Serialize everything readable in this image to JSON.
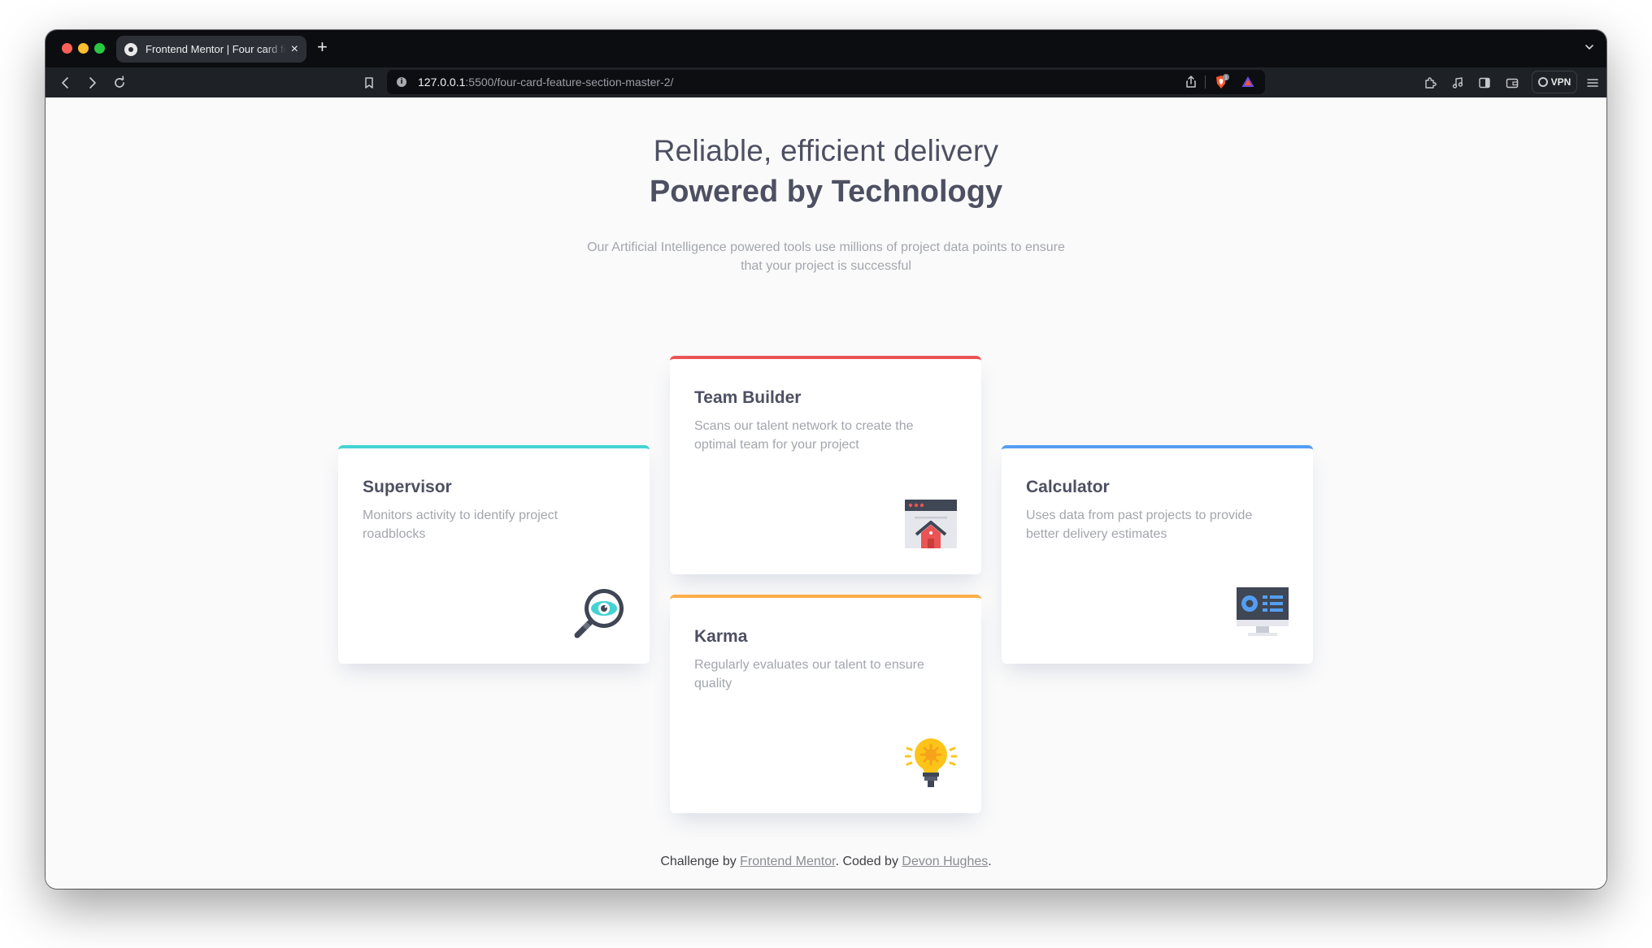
{
  "browser": {
    "tab_title": "Frontend Mentor | Four card feature section",
    "tab_close": "×",
    "new_tab": "+",
    "url_host": "127.0.0.1",
    "url_path": ":5500/four-card-feature-section-master-2/",
    "vpn_label": "VPN",
    "brave_badge_count": "1"
  },
  "hero": {
    "line1": "Reliable, efficient delivery",
    "line2": "Powered by Technology",
    "description": "Our Artificial Intelligence powered tools use millions of project data points to ensure that your project is successful"
  },
  "cards": {
    "supervisor": {
      "title": "Supervisor",
      "desc": "Monitors activity to identify project roadblocks",
      "accent": "#44d3d2",
      "icon": "magnifier-icon"
    },
    "team_builder": {
      "title": "Team Builder",
      "desc": "Scans our talent network to create the optimal team for your project",
      "accent": "#ea5454",
      "icon": "team-builder-icon"
    },
    "karma": {
      "title": "Karma",
      "desc": "Regularly evaluates our talent to ensure quality",
      "accent": "#fcae4a",
      "icon": "lightbulb-icon"
    },
    "calculator": {
      "title": "Calculator",
      "desc": "Uses data from past projects to provide better delivery estimates",
      "accent": "#549ef2",
      "icon": "monitor-icon"
    }
  },
  "footer": {
    "prefix": "Challenge by ",
    "link1": "Frontend Mentor",
    "middle": ". Coded by ",
    "link2": "Devon Hughes",
    "suffix": "."
  }
}
